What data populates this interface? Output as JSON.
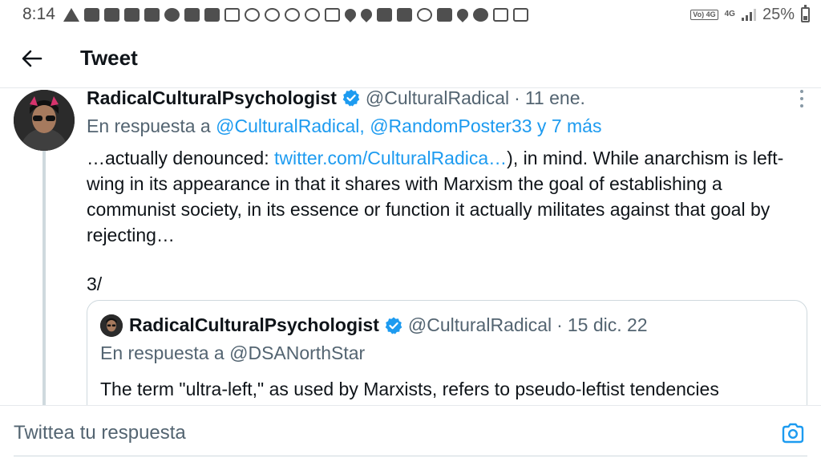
{
  "status_bar": {
    "time": "8:14",
    "notification_icons": [
      "warning-icon",
      "message-icon",
      "facebook-icon",
      "youtube-icon",
      "youtube-icon",
      "messenger-icon",
      "calendar-icon",
      "twitter-icon",
      "pocket-icon",
      "settings-icon",
      "fan-icon",
      "fan-icon",
      "fan-icon",
      "gmail-icon",
      "location-icon",
      "location-icon",
      "youtube-icon",
      "image-icon",
      "whatsapp-icon",
      "shopping-bag-icon",
      "location-icon",
      "cloud-icon",
      "window-icon",
      "window-icon"
    ],
    "volte_label": "Vo) 4G",
    "network_label": "4G",
    "battery": "25%"
  },
  "header": {
    "title": "Tweet"
  },
  "tweet": {
    "author_name": "RadicalCulturalPsychologist",
    "handle": "@CulturalRadical",
    "separator": "·",
    "date": "11 ene.",
    "reply_prefix": "En respuesta a",
    "reply_to": "@CulturalRadical, @RandomPoster33 y 7 más",
    "text_before_link": "…actually denounced: ",
    "link": "twitter.com/CulturalRadica…",
    "text_after_link": "), in mind. While anarchism is left-wing in its appearance in that it shares with Marxism the goal of establishing a communist society, in its essence or function it actually militates against that goal by rejecting…",
    "thread_count": "3/",
    "quote": {
      "author_name": "RadicalCulturalPsychologist",
      "handle": "@CulturalRadical",
      "separator": "·",
      "date": "15 dic. 22",
      "reply_prefix": "En respuesta a",
      "reply_to": "@DSANorthStar",
      "text": "The term \"ultra-left,\" as used by Marxists, refers to pseudo-leftist tendencies"
    }
  },
  "composer": {
    "placeholder": "Twittea tu respuesta"
  },
  "colors": {
    "accent": "#1d9bf0",
    "secondary_text": "#536471",
    "primary_text": "#0f1419",
    "border": "#cfd9de"
  }
}
